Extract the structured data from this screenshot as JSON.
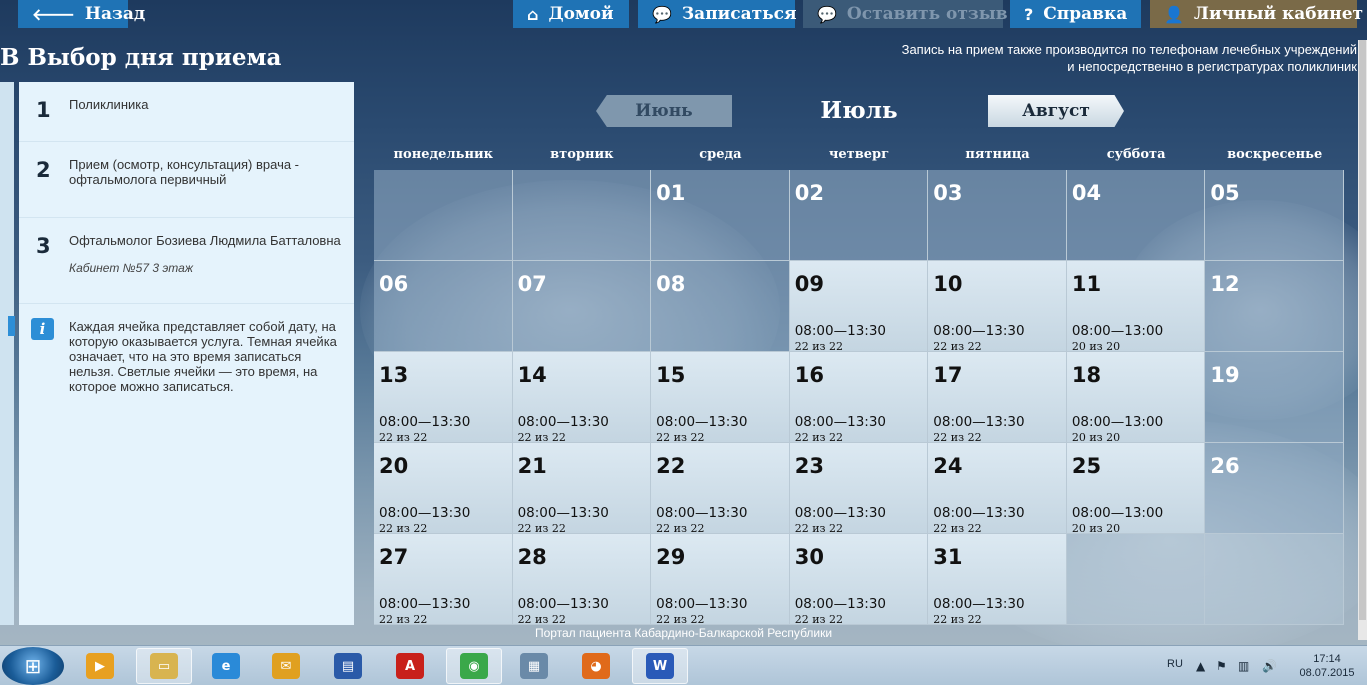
{
  "nav": {
    "back": "Назад",
    "home": "Домой",
    "signup": "Записаться",
    "feedback": "Оставить отзыв",
    "help": "Справка",
    "cabinet": "Личный кабинет"
  },
  "page": {
    "title": "Выбор дня приема",
    "title_prefix": "В",
    "notice_line1": "Запись на прием также производится по телефонам лечебных учреждений",
    "notice_line2": "и непосредственно в регистратурах поликлиник"
  },
  "steps": [
    {
      "num": "1",
      "text": "Поликлиника"
    },
    {
      "num": "2",
      "text": "Прием (осмотр, консультация) врача - офтальмолога первичный"
    },
    {
      "num": "3",
      "text": "Офтальмолог Бозиева Людмила Батталовна",
      "sub": "Кабинет №57 3 этаж"
    }
  ],
  "info": {
    "icon": "info-icon",
    "text": "Каждая ячейка представляет собой дату, на которую оказывается услуга. Темная ячейка означает, что на это время записаться нельзя. Светлые ячейки — это время, на которое можно записаться."
  },
  "calendar": {
    "prev_month": "Июнь",
    "current_month": "Июль",
    "next_month": "Август",
    "weekdays": [
      "понедельник",
      "вторник",
      "среда",
      "четверг",
      "пятница",
      "суббота",
      "воскресенье"
    ],
    "days": [
      {
        "day": "",
        "state": "blocked"
      },
      {
        "day": "",
        "state": "blocked"
      },
      {
        "day": "01",
        "state": "blocked"
      },
      {
        "day": "02",
        "state": "blocked"
      },
      {
        "day": "03",
        "state": "blocked"
      },
      {
        "day": "04",
        "state": "blocked"
      },
      {
        "day": "05",
        "state": "blocked"
      },
      {
        "day": "06",
        "state": "blocked"
      },
      {
        "day": "07",
        "state": "blocked"
      },
      {
        "day": "08",
        "state": "blocked"
      },
      {
        "day": "09",
        "state": "open",
        "time": "08:00—13:30",
        "slots": "22 из 22"
      },
      {
        "day": "10",
        "state": "open",
        "time": "08:00—13:30",
        "slots": "22 из 22"
      },
      {
        "day": "11",
        "state": "open",
        "time": "08:00—13:00",
        "slots": "20 из 20"
      },
      {
        "day": "12",
        "state": "blocked"
      },
      {
        "day": "13",
        "state": "open",
        "time": "08:00—13:30",
        "slots": "22 из 22"
      },
      {
        "day": "14",
        "state": "open",
        "time": "08:00—13:30",
        "slots": "22 из 22"
      },
      {
        "day": "15",
        "state": "open",
        "time": "08:00—13:30",
        "slots": "22 из 22"
      },
      {
        "day": "16",
        "state": "open",
        "time": "08:00—13:30",
        "slots": "22 из 22"
      },
      {
        "day": "17",
        "state": "open",
        "time": "08:00—13:30",
        "slots": "22 из 22"
      },
      {
        "day": "18",
        "state": "open",
        "time": "08:00—13:00",
        "slots": "20 из 20"
      },
      {
        "day": "19",
        "state": "blocked"
      },
      {
        "day": "20",
        "state": "open",
        "time": "08:00—13:30",
        "slots": "22 из 22"
      },
      {
        "day": "21",
        "state": "open",
        "time": "08:00—13:30",
        "slots": "22 из 22"
      },
      {
        "day": "22",
        "state": "open",
        "time": "08:00—13:30",
        "slots": "22 из 22"
      },
      {
        "day": "23",
        "state": "open",
        "time": "08:00—13:30",
        "slots": "22 из 22"
      },
      {
        "day": "24",
        "state": "open",
        "time": "08:00—13:30",
        "slots": "22 из 22"
      },
      {
        "day": "25",
        "state": "open",
        "time": "08:00—13:00",
        "slots": "20 из 20"
      },
      {
        "day": "26",
        "state": "blocked"
      },
      {
        "day": "27",
        "state": "open",
        "time": "08:00—13:30",
        "slots": "22 из 22"
      },
      {
        "day": "28",
        "state": "open",
        "time": "08:00—13:30",
        "slots": "22 из 22"
      },
      {
        "day": "29",
        "state": "open",
        "time": "08:00—13:30",
        "slots": "22 из 22"
      },
      {
        "day": "30",
        "state": "open",
        "time": "08:00—13:30",
        "slots": "22 из 22"
      },
      {
        "day": "31",
        "state": "open",
        "time": "08:00—13:30",
        "slots": "22 из 22"
      },
      {
        "day": "",
        "state": "empty"
      },
      {
        "day": "",
        "state": "empty"
      }
    ]
  },
  "footer": "Портал пациента Кабардино-Балкарской Республики",
  "taskbar": {
    "items": [
      {
        "name": "media-player-icon",
        "glyph": "▶",
        "color": "#e8a020"
      },
      {
        "name": "file-explorer-icon",
        "glyph": "▭",
        "color": "#d8b450",
        "active": true
      },
      {
        "name": "internet-explorer-icon",
        "glyph": "e",
        "color": "#2a8ad8"
      },
      {
        "name": "outlook-icon",
        "glyph": "✉",
        "color": "#e0a020"
      },
      {
        "name": "save-app-icon",
        "glyph": "▤",
        "color": "#2a5aa8"
      },
      {
        "name": "pdf-reader-icon",
        "glyph": "A",
        "color": "#c8201a"
      },
      {
        "name": "chrome-icon",
        "glyph": "◉",
        "color": "#3aa84a",
        "active": true
      },
      {
        "name": "calculator-icon",
        "glyph": "▦",
        "color": "#6a8aa8"
      },
      {
        "name": "firefox-icon",
        "glyph": "◕",
        "color": "#e06a1a"
      },
      {
        "name": "word-icon",
        "glyph": "W",
        "color": "#2a5ab8",
        "active": true
      }
    ],
    "lang": "RU",
    "time": "17:14",
    "date": "08.07.2015"
  },
  "colors": {
    "nav_blue": "#1f73b5",
    "panel_bg": "#e5f3fc",
    "open_cell": "#dce9f2"
  }
}
